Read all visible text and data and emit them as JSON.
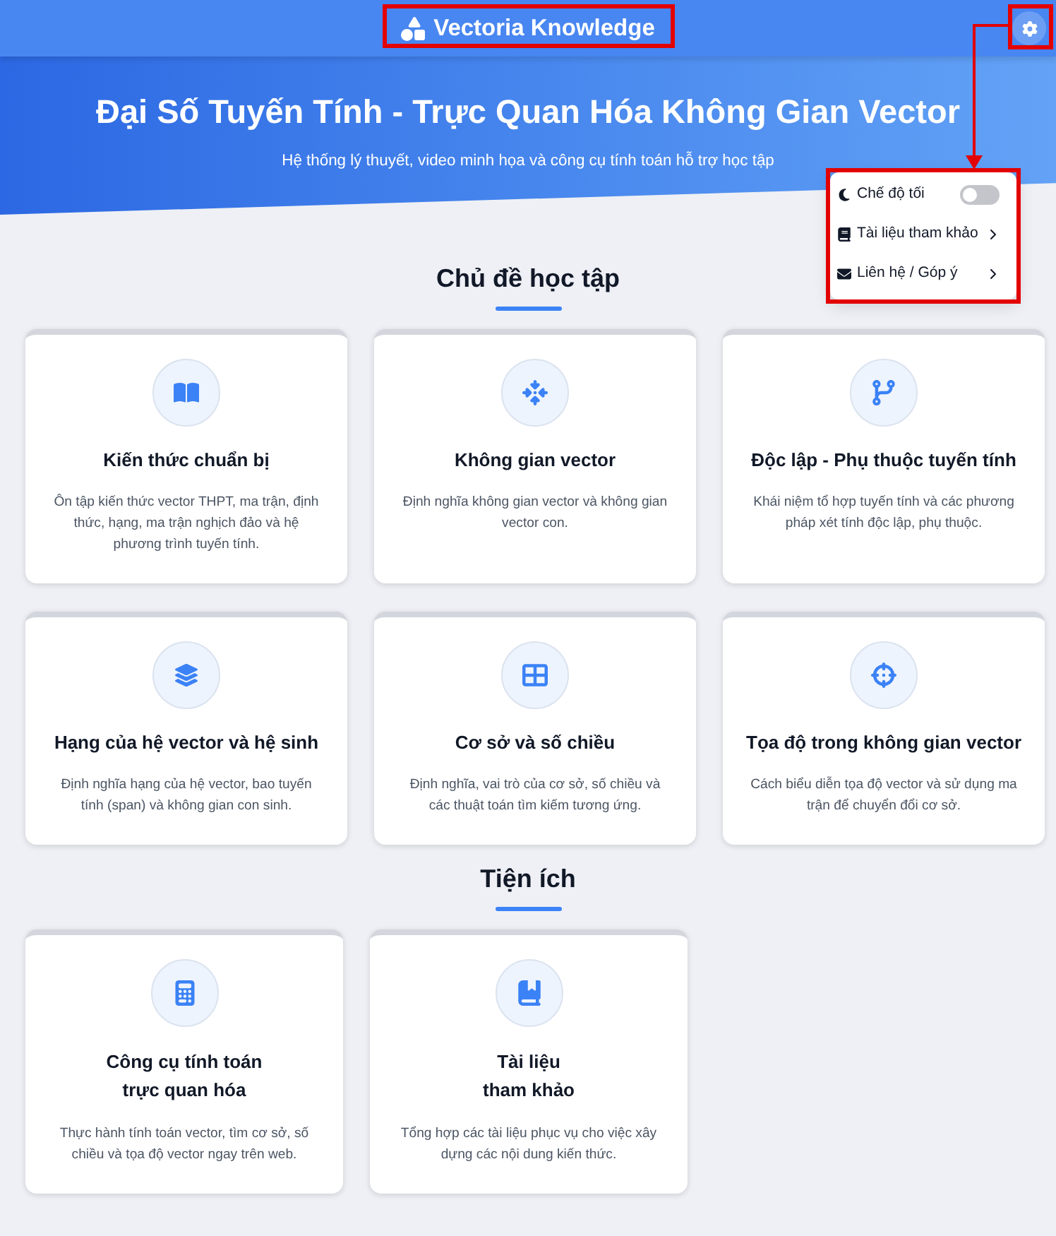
{
  "header": {
    "brand": "Vectoria Knowledge"
  },
  "hero": {
    "title": "Đại Số Tuyến Tính - Trực Quan Hóa Không Gian Vector",
    "subtitle": "Hệ thống lý thuyết, video minh họa và công cụ tính toán hỗ trợ học tập"
  },
  "settings_menu": {
    "items": [
      {
        "kind": "toggle",
        "label": "Chế độ tối",
        "on": false
      },
      {
        "kind": "link",
        "label": "Tài liệu tham khảo"
      },
      {
        "kind": "link",
        "label": "Liên hệ / Góp ý"
      }
    ]
  },
  "sections": [
    {
      "title": "Chủ đề học tập",
      "cards": [
        {
          "title_lines": [
            "Kiến thức chuẩn bị"
          ],
          "description": "Ôn tập kiến thức vector THPT, ma trận, định thức, hạng, ma trận nghịch đảo và hệ phương trình tuyến tính."
        },
        {
          "title_lines": [
            "Không gian vector"
          ],
          "description": "Định nghĩa không gian vector và không gian vector con."
        },
        {
          "title_lines": [
            "Độc lập - Phụ thuộc tuyến tính"
          ],
          "description": "Khái niệm tổ hợp tuyến tính và các phương pháp xét tính độc lập, phụ thuộc."
        },
        {
          "title_lines": [
            "Hạng của hệ vector và hệ sinh"
          ],
          "description": "Định nghĩa hạng của hệ vector, bao tuyến tính (span) và không gian con sinh."
        },
        {
          "title_lines": [
            "Cơ sở và số chiều"
          ],
          "description": "Định nghĩa, vai trò của cơ sở, số chiều và các thuật toán tìm kiếm tương ứng."
        },
        {
          "title_lines": [
            "Tọa độ trong không gian vector"
          ],
          "description": "Cách biểu diễn tọa độ vector và sử dụng ma trận để chuyển đổi cơ sở."
        }
      ]
    },
    {
      "title": "Tiện ích",
      "cards": [
        {
          "title_lines": [
            "Công cụ tính toán",
            "trực quan hóa"
          ],
          "description": "Thực hành tính toán vector, tìm cơ sở, số chiều và tọa độ vector ngay trên web."
        },
        {
          "title_lines": [
            "Tài liệu",
            "tham khảo"
          ],
          "description": "Tổng hợp các tài liệu phục vụ cho việc xây dựng các nội dung kiến thức."
        }
      ]
    }
  ]
}
